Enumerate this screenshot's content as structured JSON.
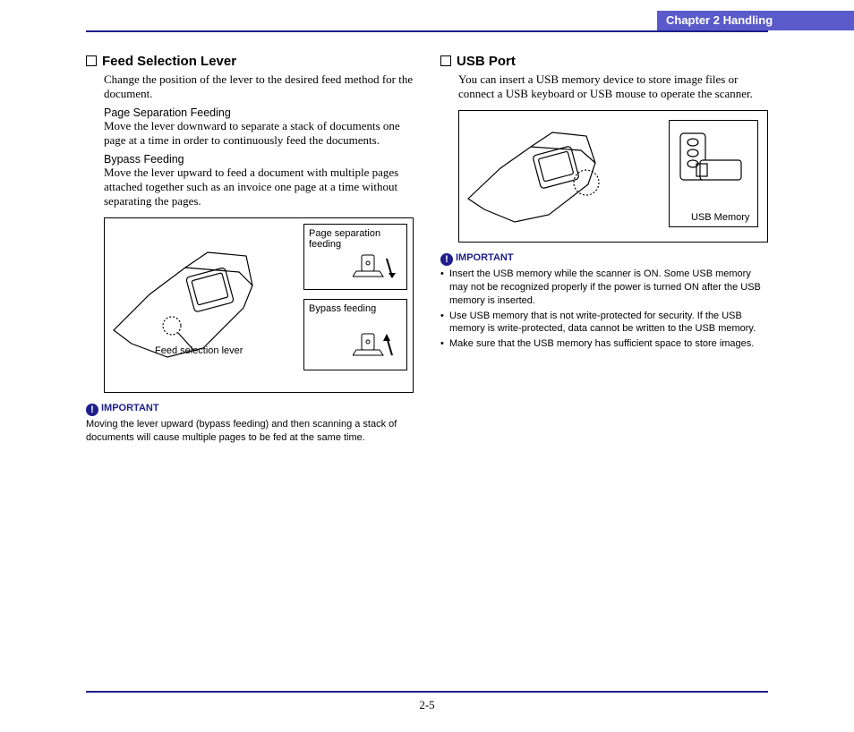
{
  "header": {
    "chapter": "Chapter 2   Handling"
  },
  "left": {
    "title": "Feed Selection Lever",
    "intro": "Change the position of the lever to the desired feed method for the document.",
    "sub1_title": "Page Separation Feeding",
    "sub1_body": "Move the lever downward to separate a stack of documents one page at a time in order to continuously feed the documents.",
    "sub2_title": "Bypass Feeding",
    "sub2_body": "Move the lever upward to feed a document with multiple pages attached together such as an invoice one page at a time without separating the pages.",
    "callout_feed_lever": "Feed selection lever",
    "inset1_label": "Page separation feeding",
    "inset2_label": "Bypass feeding",
    "important_label": "IMPORTANT",
    "important_body": "Moving the lever upward (bypass feeding) and then scanning a stack of documents will cause multiple pages to be fed at the same time."
  },
  "right": {
    "title": "USB Port",
    "intro": "You can insert a USB memory device to store image files or connect a USB keyboard or USB mouse to operate the scanner.",
    "usb_mem_label": "USB Memory",
    "important_label": "IMPORTANT",
    "bullets": [
      "Insert the USB memory while the scanner is ON. Some USB memory may not be recognized properly if the power is turned ON after the USB memory is inserted.",
      "Use USB memory that is not write-protected for security. If the USB memory is write-protected, data cannot be written to the USB memory.",
      "Make sure that the USB memory has sufficient space to store images."
    ]
  },
  "page_number": "2-5"
}
